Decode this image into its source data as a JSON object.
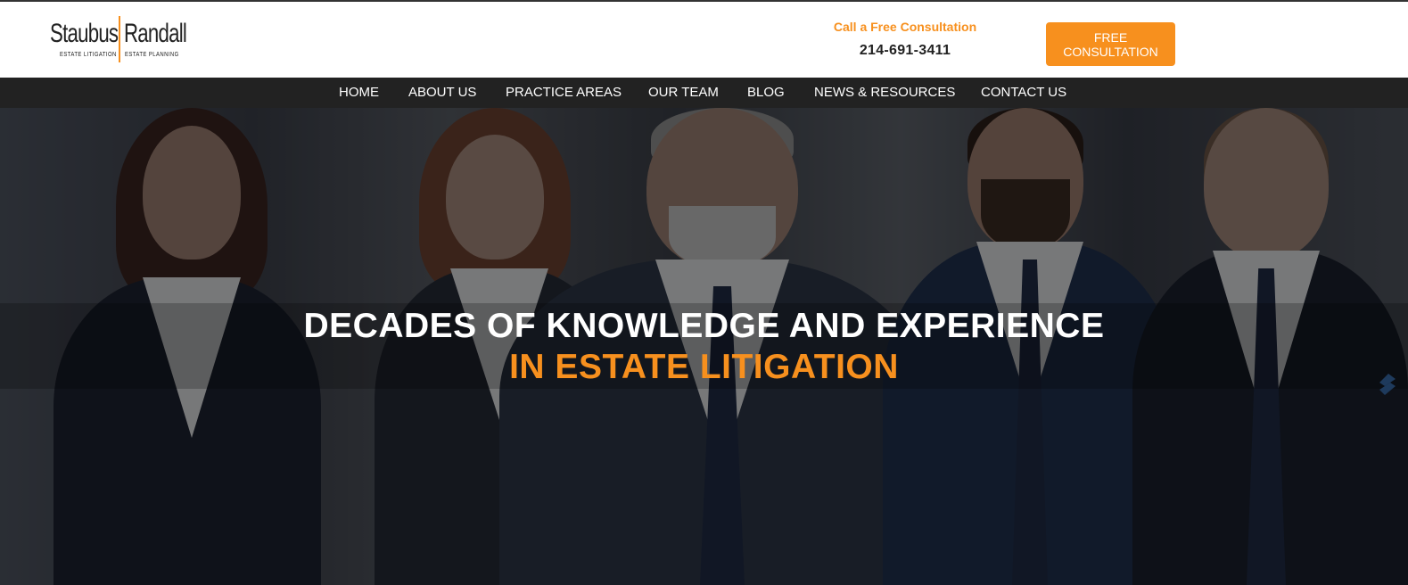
{
  "brand": {
    "name_left": "Staubus",
    "name_right": "Randall",
    "tag_left": "ESTATE LITIGATION",
    "tag_right": "ESTATE PLANNING",
    "accent_color": "#f7901e",
    "dark_color": "#222222"
  },
  "header": {
    "cta_label": "Call a Free Consultation",
    "phone": "214-691-3411",
    "button_line1": "FREE",
    "button_line2": "CONSULTATION"
  },
  "nav": {
    "items": [
      {
        "label": "HOME"
      },
      {
        "label": "ABOUT US"
      },
      {
        "label": "PRACTICE AREAS"
      },
      {
        "label": "OUR TEAM"
      },
      {
        "label": "BLOG"
      },
      {
        "label": "NEWS & RESOURCES"
      },
      {
        "label": "CONTACT US"
      }
    ]
  },
  "hero": {
    "headline_line1": "DECADES OF KNOWLEDGE AND EXPERIENCE",
    "headline_line2": "IN ESTATE LITIGATION",
    "image_subject": "group of business professionals in suits with crossed arms",
    "side_icon": "accessibility-icon"
  }
}
